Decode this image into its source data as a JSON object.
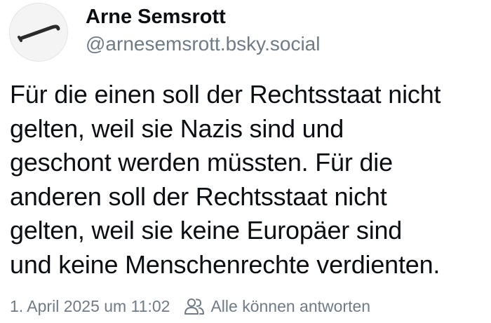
{
  "post": {
    "author": {
      "display_name": "Arne Semsrott",
      "handle": "@arnesemsrott.bsky.social",
      "avatar_icon": "crowbar-icon"
    },
    "text": "Für die einen soll der Rechtsstaat nicht\ngelten, weil sie Nazis sind und\ngeschont werden müssten. Für die\nanderen soll der Rechtsstaat nicht\ngelten, weil sie keine Europäer sind\nund keine Menschenrechte verdienten.",
    "timestamp": "1. April 2025 um 11:02",
    "reply_setting_icon": "people-icon",
    "reply_setting": "Alle können antworten"
  },
  "colors": {
    "text": "#0b0f14",
    "muted": "#6f7b87"
  }
}
